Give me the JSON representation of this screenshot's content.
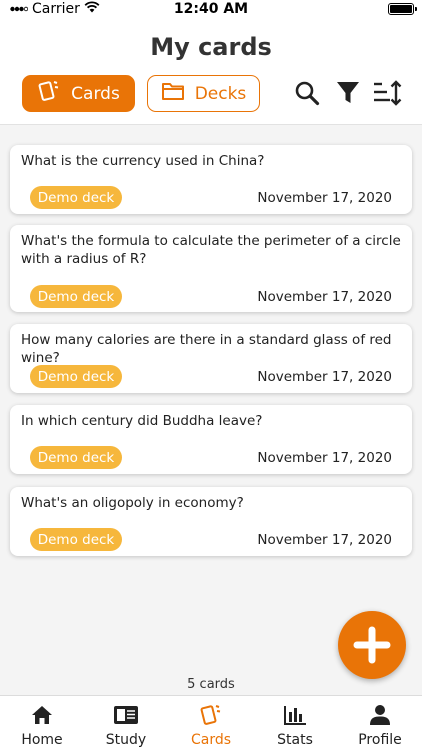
{
  "status_bar": {
    "carrier": "Carrier",
    "time": "12:40 AM"
  },
  "header": {
    "title": "My cards"
  },
  "segments": [
    {
      "label": "Cards",
      "active": true
    },
    {
      "label": "Decks",
      "active": false
    }
  ],
  "toolbar": {
    "icons": [
      "search-icon",
      "filter-icon",
      "sort-icon"
    ]
  },
  "cards": [
    {
      "question": "What is the currency used in China?",
      "deck": "Demo deck",
      "date": "November 17, 2020"
    },
    {
      "question": "What's the formula to calculate the perimeter of a circle with a radius of R?",
      "deck": "Demo deck",
      "date": "November 17, 2020"
    },
    {
      "question": "How many calories are there in a standard glass of red wine?",
      "deck": "Demo deck",
      "date": "November 17, 2020"
    },
    {
      "question": "In which century did Buddha leave?",
      "deck": "Demo deck",
      "date": "November 17, 2020"
    },
    {
      "question": "What's an oligopoly in economy?",
      "deck": "Demo deck",
      "date": "November 17, 2020"
    }
  ],
  "card_count": "5 cards",
  "tabs": [
    {
      "label": "Home",
      "active": false
    },
    {
      "label": "Study",
      "active": false
    },
    {
      "label": "Cards",
      "active": true
    },
    {
      "label": "Stats",
      "active": false
    },
    {
      "label": "Profile",
      "active": false
    }
  ],
  "colors": {
    "accent": "#e97407",
    "tag": "#f6b73c",
    "background": "#f4f4f4"
  }
}
